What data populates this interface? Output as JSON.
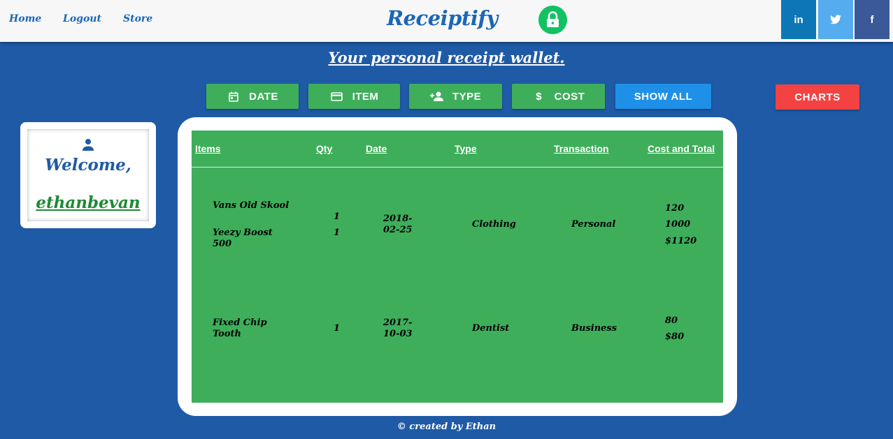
{
  "nav": {
    "home": "Home",
    "logout": "Logout",
    "store": "Store"
  },
  "brand": "Receiptify",
  "social": {
    "linkedin": "in",
    "twitter": "t",
    "facebook": "f"
  },
  "tagline": "Your personal receipt wallet.",
  "filters": {
    "date": "DATE",
    "item": "ITEM",
    "type": "TYPE",
    "cost": "COST",
    "show_all": "SHOW ALL",
    "charts": "CHARTS"
  },
  "welcome": {
    "greeting": "Welcome,",
    "username": "ethanbevan"
  },
  "table": {
    "headers": [
      "Items",
      "Qty",
      "Date",
      "Type",
      "Transaction",
      "Cost and Total"
    ],
    "rows": [
      {
        "items": [
          "Vans Old Skool",
          "Yeezy Boost 500"
        ],
        "qty": [
          "1",
          "1"
        ],
        "date": "2018-02-25",
        "type": "Clothing",
        "transaction": "Personal",
        "costs": [
          "120",
          "1000"
        ],
        "total": "$1120"
      },
      {
        "items": [
          "Fixed Chip Tooth"
        ],
        "qty": [
          "1"
        ],
        "date": "2017-10-03",
        "type": "Dentist",
        "transaction": "Business",
        "costs": [
          "80"
        ],
        "total": "$80"
      }
    ]
  },
  "footer": "© created by Ethan",
  "colors": {
    "bg": "#1f5aa6",
    "green": "#3fae5b",
    "blue_btn": "#1e90e8",
    "red_btn": "#f44242",
    "brand": "#1a66b8"
  }
}
